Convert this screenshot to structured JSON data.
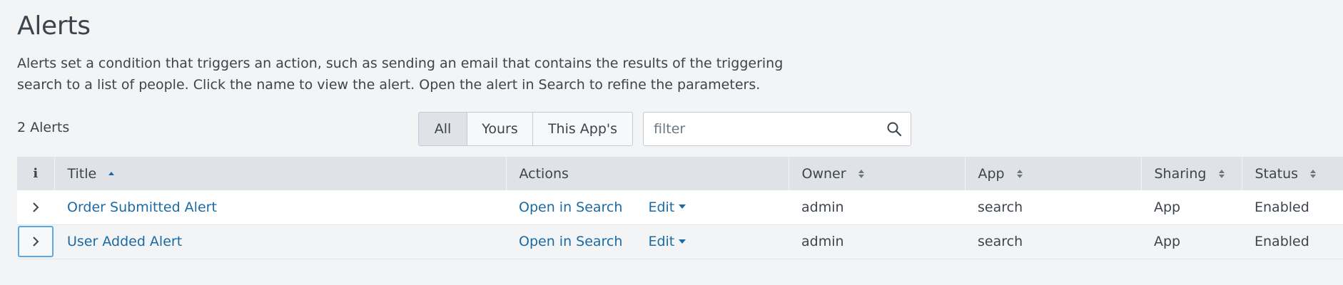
{
  "page": {
    "title": "Alerts",
    "description": "Alerts set a condition that triggers an action, such as sending an email that contains the results of the triggering search to a list of people. Click the name to view the alert. Open the alert in Search to refine the parameters."
  },
  "toolbar": {
    "count_label": "2 Alerts",
    "filters": [
      {
        "label": "All",
        "active": true
      },
      {
        "label": "Yours",
        "active": false
      },
      {
        "label": "This App's",
        "active": false
      }
    ],
    "search": {
      "placeholder": "filter",
      "value": "",
      "icon": "search-icon"
    }
  },
  "table": {
    "columns": {
      "info": "i",
      "title": "Title",
      "actions": "Actions",
      "owner": "Owner",
      "app": "App",
      "sharing": "Sharing",
      "status": "Status"
    },
    "rows": [
      {
        "title": "Order Submitted Alert",
        "open_label": "Open in Search",
        "edit_label": "Edit",
        "owner": "admin",
        "app": "search",
        "sharing": "App",
        "status": "Enabled"
      },
      {
        "title": "User Added Alert",
        "open_label": "Open in Search",
        "edit_label": "Edit",
        "owner": "admin",
        "app": "search",
        "sharing": "App",
        "status": "Enabled"
      }
    ]
  },
  "colors": {
    "link": "#1a6aa5",
    "header_bg": "#dfe3e8",
    "page_bg": "#f2f4f5",
    "focus_ring": "#5ca8e0"
  }
}
